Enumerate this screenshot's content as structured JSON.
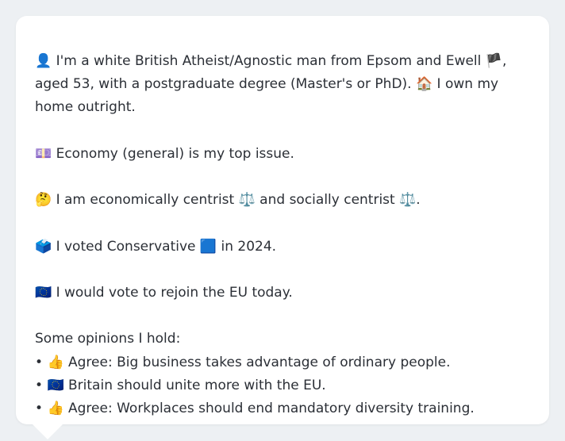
{
  "profile": {
    "intro": {
      "person_emoji": "👤",
      "text_a": " I'm a white British Atheist/Agnostic man from Epsom and Ewell ",
      "flag_emoji": "🏴",
      "text_b": ", aged 53, with a postgraduate degree (Master's or PhD). ",
      "house_emoji": "🏠",
      "text_c": " I own my home outright."
    },
    "top_issue": {
      "emoji": "💷",
      "text": " Economy (general) is my top issue."
    },
    "position": {
      "emoji": "🤔",
      "text_a": " I am economically centrist ",
      "scale_emoji_1": "⚖️",
      "text_b": " and socially centrist ",
      "scale_emoji_2": "⚖️",
      "text_c": "."
    },
    "vote": {
      "emoji": "🗳️",
      "text_a": " I voted Conservative ",
      "party_emoji": "🟦",
      "text_b": " in 2024."
    },
    "eu": {
      "emoji": "🇪🇺",
      "text": " I would vote to rejoin the EU today."
    },
    "opinions": {
      "heading": "Some opinions I hold:",
      "items": [
        {
          "bullet": "•",
          "emoji": "👍",
          "text": " Agree: Big business takes advantage of ordinary people."
        },
        {
          "bullet": "•",
          "emoji": "🇪🇺",
          "text": " Britain should unite more with the EU."
        },
        {
          "bullet": "•",
          "emoji": "👍",
          "text": " Agree: Workplaces should end mandatory diversity training."
        }
      ]
    }
  },
  "colors": {
    "background": "#edf0f3",
    "card": "#ffffff",
    "text": "#2b2f36"
  }
}
